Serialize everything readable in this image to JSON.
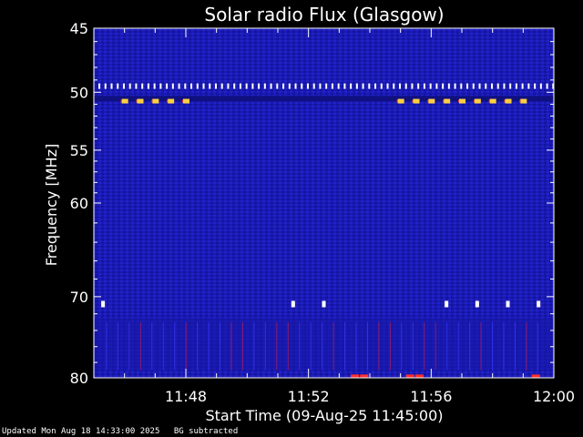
{
  "chart_data": {
    "type": "heatmap",
    "title": "Solar radio Flux (Glasgow)",
    "xlabel": "Start Time (09-Aug-25 11:45:00)",
    "ylabel": "Frequency [MHz]",
    "xlim_minutes": [
      0,
      15
    ],
    "ylim": [
      45,
      80
    ],
    "x_ticks": [
      {
        "label": "11:48",
        "minute": 3
      },
      {
        "label": "11:52",
        "minute": 7
      },
      {
        "label": "11:56",
        "minute": 11
      },
      {
        "label": "12:00",
        "minute": 15
      }
    ],
    "y_ticks": [
      45,
      50,
      55,
      60,
      70,
      80
    ],
    "background_color": "#1a1ab4",
    "bands": [
      {
        "freq": 49.5,
        "kind": "comb",
        "color": "#ffffff"
      },
      {
        "freq": 50.7,
        "kind": "sparse",
        "color": "#ffd040"
      },
      {
        "freq": 70.8,
        "kind": "sparse",
        "color": "#ffffff"
      },
      {
        "freq": 79.8,
        "kind": "sparse",
        "color": "#ff3030"
      }
    ],
    "hot_spots_50MHz_minutes": [
      1.0,
      1.5,
      2.0,
      2.5,
      3.0,
      10.0,
      10.5,
      11.0,
      11.5,
      12.0,
      12.5,
      13.0,
      13.5,
      14.0
    ],
    "hot_spots_71MHz_minutes": [
      0.3,
      6.5,
      7.5,
      11.5,
      12.5,
      13.5,
      14.5
    ]
  },
  "footer": {
    "updated": "Updated Mon Aug 18 14:33:00 2025",
    "note": "BG subtracted"
  }
}
